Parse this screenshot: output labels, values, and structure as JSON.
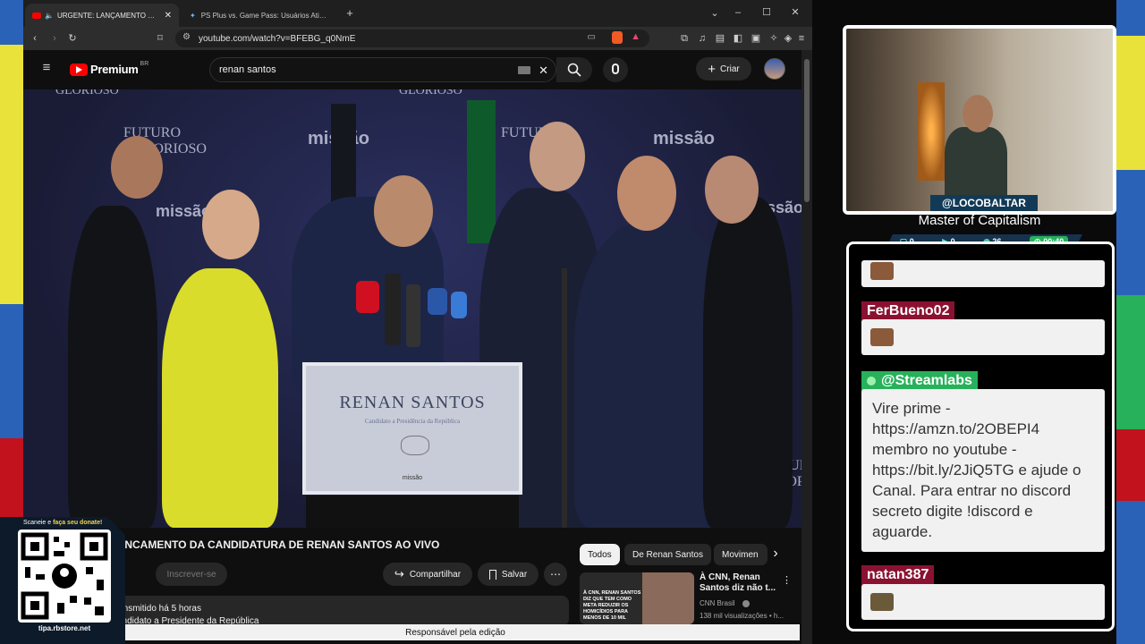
{
  "browser": {
    "tabs": [
      {
        "title": "URGENTE: LANÇAMENTO DA CAN...",
        "active": true
      },
      {
        "title": "PS Plus vs. Game Pass: Usuários Ativos - Goo...",
        "active": false
      }
    ],
    "new_tab_symbol": "+",
    "url": "youtube.com/watch?v=BFEBG_q0NmE"
  },
  "youtube": {
    "logo_text": "Premium",
    "region": "BR",
    "search_value": "renan santos",
    "create_label": "Criar",
    "video": {
      "backdrop_words": [
        "GLORIOSO",
        "GLORIOSO",
        "FUTURO",
        "GLORIOSO",
        "missão",
        "missão",
        "FUTURO",
        "missão",
        "missão",
        "FUTURO",
        "GLORIOSO"
      ],
      "podium_name": "RENAN SANTOS",
      "podium_subtitle": "Candidato a Presidência da República",
      "podium_logo": "missão"
    },
    "title": "CANCAMENTO DA CANDIDATURA DE RENAN SANTOS AO VIVO",
    "subscribe_label": "Inscrever-se",
    "share_label": "Compartilhar",
    "save_label": "Salvar",
    "chips": [
      "Todos",
      "De Renan Santos",
      "Movimen"
    ],
    "description_line1": "transmitido há 5 horas",
    "description_line2": "candidato a Presidente da República",
    "recommendation": {
      "title": "À CNN, Renan Santos diz não t...",
      "channel": "CNN Brasil",
      "meta": "138 mil visualizações • h...",
      "thumb_text": "À CNN, RENAN SANTOS DIZ QUE TEM COMO META REDUZIR OS HOMICÍDIOS PARA MENOS DE 10 MIL"
    },
    "bottom_bar": "Responsável pela edição"
  },
  "qr": {
    "caption_top_prefix": "Scaneie e ",
    "caption_top_highlight": "faça seu donate!",
    "caption_bottom": "tipa.rbstore.net"
  },
  "stream_overlay": {
    "handle": "@LOCOBALTAR",
    "title": "Master of Capitalism",
    "stats": [
      "0",
      "0",
      "26",
      "00:40"
    ]
  },
  "chat": {
    "messages": [
      {
        "user": "",
        "text": ""
      },
      {
        "user": "FerBueno02",
        "text": ""
      },
      {
        "user": "@Streamlabs",
        "text": "Vire prime - https://amzn.to/2OBEPI4 membro no youtube - https://bit.ly/2JiQ5TG e ajude o Canal. Para entrar no discord secreto digite !discord e aguarde."
      },
      {
        "user": "natan387",
        "text": ""
      }
    ]
  }
}
